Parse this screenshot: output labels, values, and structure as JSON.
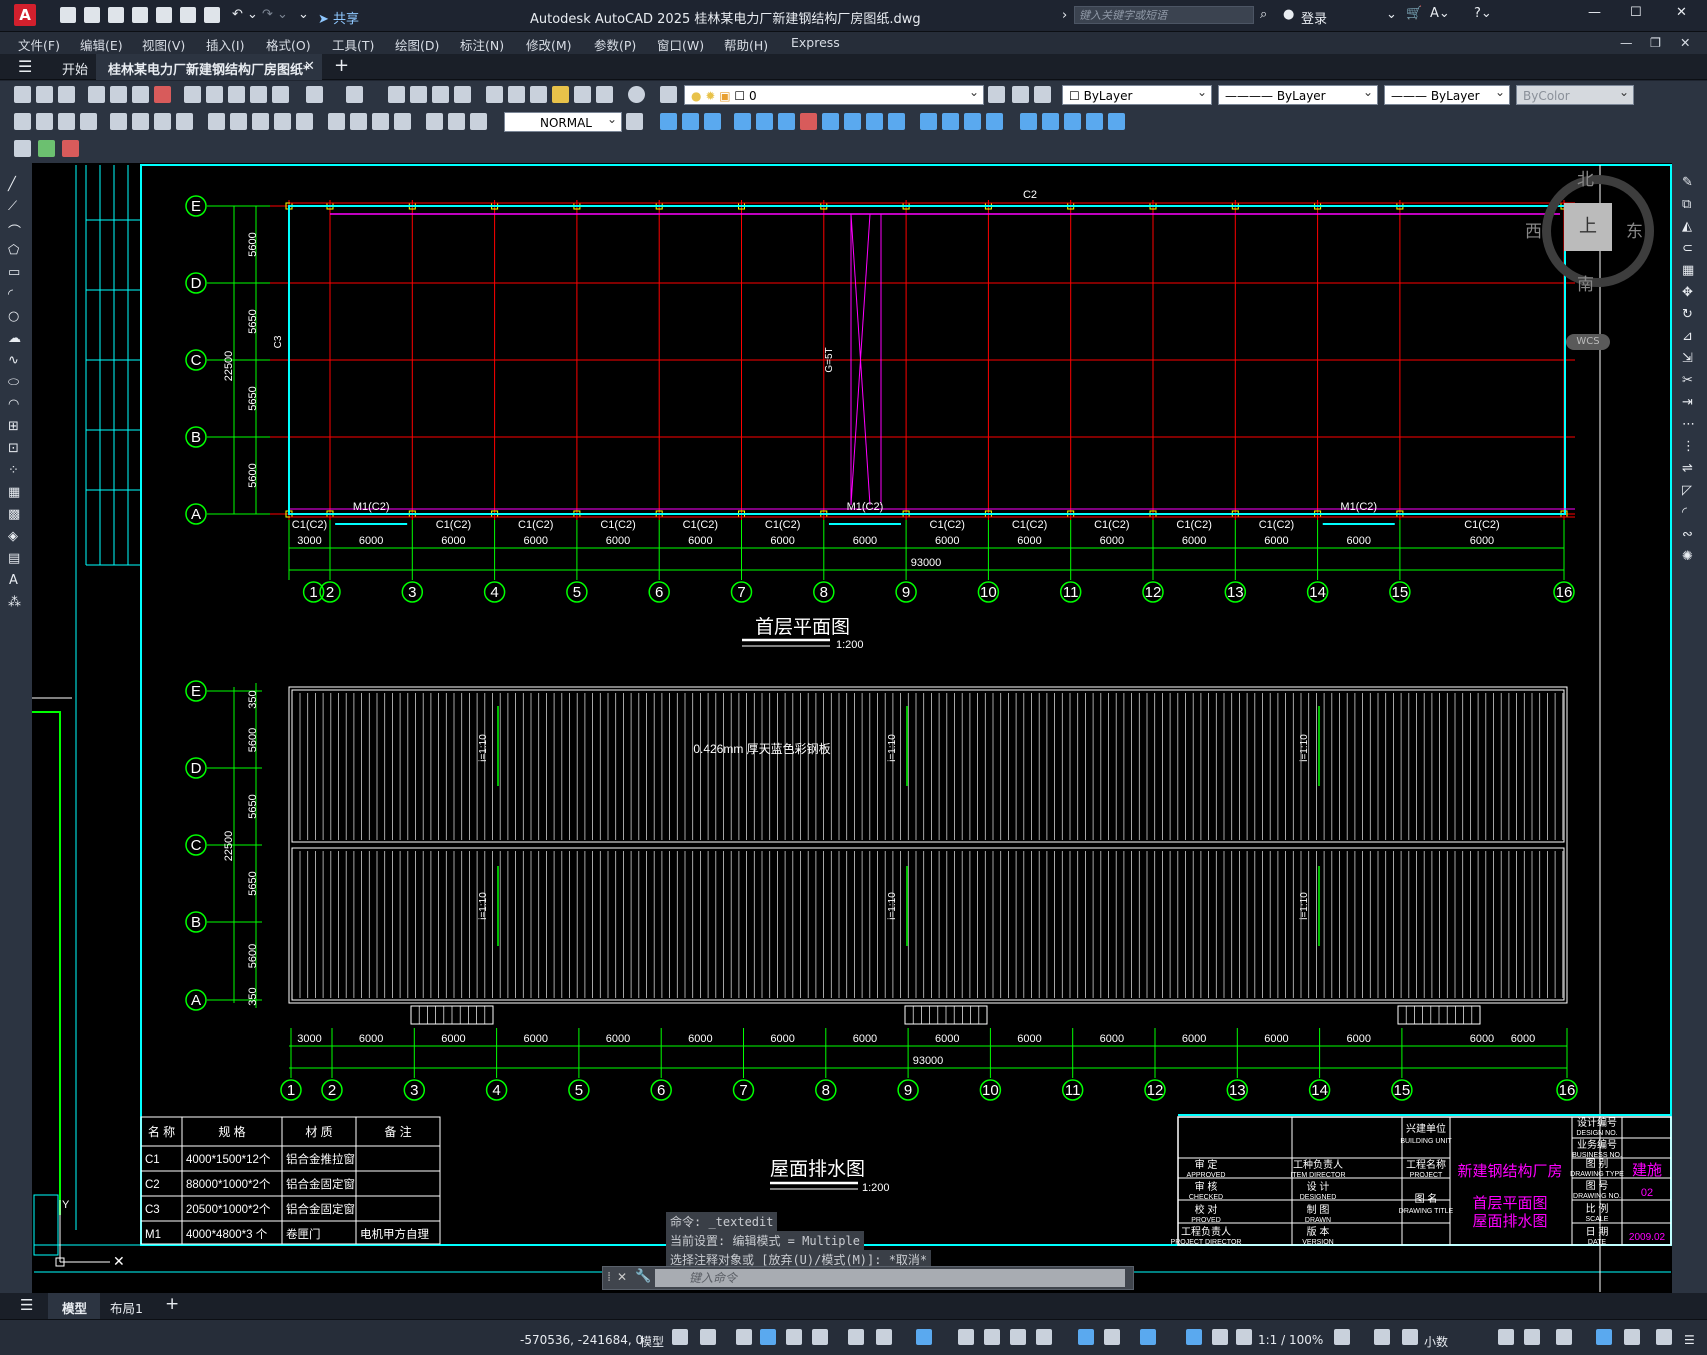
{
  "app": {
    "logo_letter": "A",
    "title": "Autodesk AutoCAD 2025    桂林某电力厂新建钢结构厂房图纸.dwg",
    "share_label": "共享",
    "search_placeholder": "键入关键字或短语",
    "login_label": "登录"
  },
  "menu": [
    "文件(F)",
    "编辑(E)",
    "视图(V)",
    "插入(I)",
    "格式(O)",
    "工具(T)",
    "绘图(D)",
    "标注(N)",
    "修改(M)",
    "参数(P)",
    "窗口(W)",
    "帮助(H)",
    "Express"
  ],
  "tabs": {
    "start": "开始",
    "document": "桂林某电力厂新建钢结构厂房图纸*"
  },
  "toolbar": {
    "layer_value": "0",
    "color_value": "ByLayer",
    "linetype_value": "ByLayer",
    "lineweight_value": "ByLayer",
    "plotstyle_value": "ByColor",
    "dimstyle_value": "NORMAL"
  },
  "viewcube": {
    "north": "北",
    "south": "南",
    "east": "东",
    "west": "西",
    "top": "上",
    "wcs": "WCS"
  },
  "drawing": {
    "axis_rows": [
      "E",
      "D",
      "C",
      "B",
      "A"
    ],
    "axis_cols": [
      "1",
      "2",
      "3",
      "4",
      "5",
      "6",
      "7",
      "8",
      "9",
      "10",
      "11",
      "12",
      "13",
      "14",
      "15",
      "16"
    ],
    "dims_left_plan": [
      "5600",
      "5650",
      "5650",
      "5600"
    ],
    "dim_total_left": "22500",
    "dims_left_roof": [
      "350",
      "5600",
      "5650",
      "5650",
      "5600",
      "350"
    ],
    "dims_bottom": [
      "3000",
      "6000",
      "6000",
      "6000",
      "6000",
      "6000",
      "6000",
      "6000",
      "6000",
      "6000",
      "6000",
      "6000",
      "6000",
      "6000",
      "6000",
      "6000"
    ],
    "dim_total_bottom": "93000",
    "window_labels": [
      "C1(C2)",
      "M1(C2)",
      "C1(C2)",
      "C1(C2)",
      "C1(C2)",
      "C1(C2)",
      "C1(C2)",
      "M1(C2)",
      "C1(C2)",
      "C1(C2)",
      "C1(C2)",
      "C1(C2)",
      "C1(C2)",
      "M1(C2)",
      "C1(C2)"
    ],
    "label_c2": "C2",
    "label_c3": "C3",
    "label_crane": "G=5T",
    "plan_title": "首层平面图",
    "plan_scale": "1:200",
    "roof_title": "屋面排水图",
    "roof_scale": "1:200",
    "roof_material": "0.426mm 厚天蓝色彩钢板",
    "slope": "i=1:10"
  },
  "schedule": {
    "headers": [
      "名 称",
      "规  格",
      "材  质",
      "备  注"
    ],
    "rows": [
      [
        "C1",
        "4000*1500*12个",
        "铝合金推拉窗",
        ""
      ],
      [
        "C2",
        "88000*1000*2个",
        "铝合金固定窗",
        ""
      ],
      [
        "C3",
        "20500*1000*2个",
        "铝合金固定窗",
        ""
      ],
      [
        "M1",
        "4000*4800*3 个",
        "卷匣门",
        "电机甲方自理"
      ]
    ]
  },
  "titleblock": {
    "building_unit": "兴建单位",
    "building_unit_en": "BUILDING UNIT",
    "approved": "审 定",
    "approved_en": "APPROVED",
    "item_director": "工种负责人",
    "item_director_en": "ITEM DIRECTOR",
    "project": "工程名称",
    "project_en": "PROJECT",
    "project_name": "新建钢结构厂房",
    "checked": "审 核",
    "checked_en": "CHECKED",
    "designed": "设 计",
    "designed_en": "DESIGNED",
    "drawing_title": "图 名",
    "drawing_title_en": "DRAWING TITLE",
    "drawing_name_1": "首层平面图",
    "drawing_name_2": "屋面排水图",
    "proved": "校 对",
    "proved_en": "PROVED",
    "drawn": "制 图",
    "drawn_en": "DRAWN",
    "project_director": "工程负责人",
    "project_director_en": "PROJECT DIRECTOR",
    "version": "版 本",
    "version_en": "VERSION",
    "design_no": "设计编号",
    "design_no_en": "DESIGN NO.",
    "business_no": "业务编号",
    "business_no_en": "BUSINESS NO.",
    "drawing_type": "图 别",
    "drawing_type_en": "DRAWING TYPE",
    "drawing_type_val": "建施",
    "drawing_no": "图 号",
    "drawing_no_en": "DRAWING NO.",
    "drawing_no_val": "02",
    "scale": "比 例",
    "scale_en": "SCALE",
    "date": "日 期",
    "date_en": "DATE",
    "date_val": "2009.02"
  },
  "command": {
    "history": [
      "命令: _textedit",
      "当前设置: 编辑模式 = Multiple",
      "选择注释对象或 [放弃(U)/模式(M)]: *取消*"
    ],
    "placeholder": "键入命令"
  },
  "layout_tabs": [
    "模型",
    "布局1"
  ],
  "status": {
    "coords": "-570536, -241684, 0",
    "model": "模型",
    "scale": "1:1 / 100%",
    "units": "小数"
  }
}
